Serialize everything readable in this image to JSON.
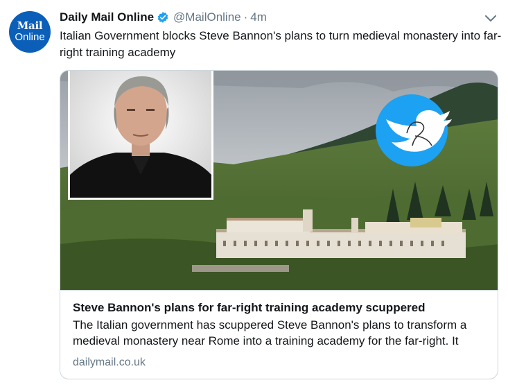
{
  "tweet": {
    "avatar": {
      "line1": "Mail",
      "line2": "Online",
      "color": "#0b5fb8"
    },
    "display_name": "Daily Mail Online",
    "handle": "@MailOnline",
    "separator": "·",
    "time": "4m",
    "verified_icon": "verified-badge",
    "text": "Italian Government blocks Steve Bannon's plans to turn medieval monastery into far-right training academy"
  },
  "card": {
    "title": "Steve Bannon's plans for far-right training academy scuppered",
    "description": "The Italian government has scuppered Steve Bannon's plans to transform a medieval monastery near Rome into a training academy for the far-right. It",
    "domain": "dailymail.co.uk"
  },
  "colors": {
    "accent": "#1da1f2",
    "secondary_text": "#657786",
    "border": "#ccd6dd"
  }
}
